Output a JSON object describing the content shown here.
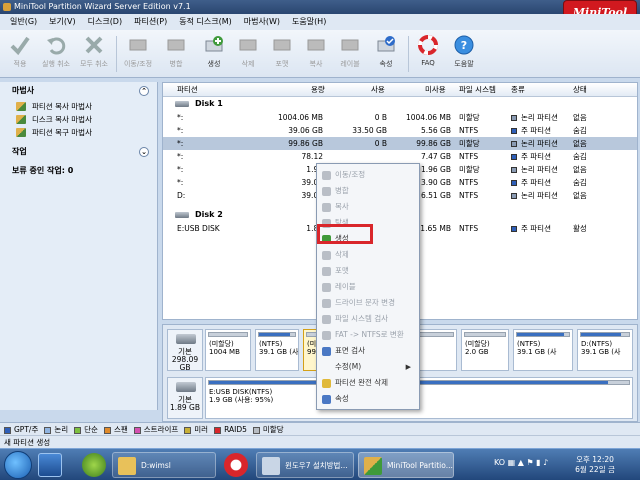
{
  "window": {
    "title": "MiniTool Partition Wizard Server Edition v7.1",
    "logo": "MiniTool"
  },
  "menu": [
    "일반(G)",
    "보기(V)",
    "디스크(D)",
    "파티션(P)",
    "동적 디스크(M)",
    "마법사(W)",
    "도움말(H)"
  ],
  "toolbar": {
    "apply": "적용",
    "undo": "실행 취소",
    "discard_all": "모두 취소",
    "move_resize": "이동/조정",
    "merge": "병합",
    "create": "생성",
    "delete": "삭제",
    "format": "포맷",
    "copy": "복사",
    "label": "레이블",
    "properties": "속성",
    "faq": "FAQ",
    "help": "도움말"
  },
  "sidebar": {
    "wizard_title": "마법사",
    "wizard_items": [
      "파티션 복사 마법사",
      "디스크 복사 마법사",
      "파티션 복구 마법사"
    ],
    "operations_title": "작업",
    "pending": "보류 중인 작업: 0"
  },
  "grid": {
    "headers": {
      "partition": "파티션",
      "capacity": "용량",
      "used": "사용",
      "unused": "미사용",
      "filesystem": "파일 시스템",
      "type": "종류",
      "status": "상태"
    },
    "disk1": "Disk 1",
    "disk2": "Disk 2",
    "rows": [
      {
        "partition": "*:",
        "capacity": "1004.06 MB",
        "used": "0 B",
        "unused": "1004.06 MB",
        "filesystem": "미할당",
        "type": "논리 파티션",
        "status": "없음",
        "type_color": "#8a9bb3"
      },
      {
        "partition": "*:",
        "capacity": "39.06 GB",
        "used": "33.50 GB",
        "unused": "5.56 GB",
        "filesystem": "NTFS",
        "type": "주 파티션",
        "status": "숨김",
        "type_color": "#2f5fb8"
      },
      {
        "partition": "*:",
        "capacity": "99.86 GB",
        "used": "0 B",
        "unused": "99.86 GB",
        "filesystem": "미할당",
        "type": "논리 파티션",
        "status": "없음",
        "type_color": "#8a9bb3"
      },
      {
        "partition": "*:",
        "capacity": "78.12",
        "used": "",
        "unused": "7.47 GB",
        "filesystem": "NTFS",
        "type": "주 파티션",
        "status": "숨김",
        "type_color": "#2f5fb8"
      },
      {
        "partition": "*:",
        "capacity": "1.96",
        "used": "",
        "unused": "1.96 GB",
        "filesystem": "미할당",
        "type": "논리 파티션",
        "status": "없음",
        "type_color": "#8a9bb3"
      },
      {
        "partition": "*:",
        "capacity": "39.05",
        "used": "",
        "unused": "3.90 GB",
        "filesystem": "NTFS",
        "type": "주 파티션",
        "status": "숨김",
        "type_color": "#2f5fb8"
      },
      {
        "partition": "D:",
        "capacity": "39.05",
        "used": "",
        "unused": "6.51 GB",
        "filesystem": "NTFS",
        "type": "논리 파티션",
        "status": "없음",
        "type_color": "#8a9bb3"
      }
    ],
    "disk2_rows": [
      {
        "partition": "E:USB DISK",
        "capacity": "1.88",
        "used": "",
        "unused": "1.65 MB",
        "filesystem": "NTFS",
        "type": "주 파티션",
        "status": "활성",
        "type_color": "#2f5fb8"
      }
    ]
  },
  "map": {
    "disk1": {
      "label": "기본",
      "size": "298.09 GB"
    },
    "disk2": {
      "label": "기본",
      "size": "1.89 GB"
    },
    "blocks": [
      {
        "name": "(미할당)",
        "size": "1004 MB",
        "fill": 0
      },
      {
        "name": "(NTFS)",
        "size": "39.1 GB (사용:",
        "fill": 85
      },
      {
        "name": "(미",
        "size": "99.9",
        "fill": 0
      },
      {
        "name": "NTFS)",
        "size": "1 GB (사용: 39%)",
        "fill": 39
      },
      {
        "name": "(미할당)",
        "size": "2.0 GB",
        "fill": 0
      },
      {
        "name": "(NTFS)",
        "size": "39.1 GB (사",
        "fill": 90
      },
      {
        "name": "D:(NTFS)",
        "size": "39.1 GB (사",
        "fill": 83
      }
    ],
    "usb": {
      "name": "E:USB DISK(NTFS)",
      "size": "1.9 GB (사용: 95%)",
      "fill": 95
    }
  },
  "context_menu": {
    "items": [
      {
        "label": "이동/조정",
        "disabled": true,
        "icon": "gray"
      },
      {
        "label": "병합",
        "disabled": true,
        "icon": "gray"
      },
      {
        "label": "복사",
        "disabled": true,
        "icon": "gray"
      },
      {
        "label": "탐색",
        "disabled": true,
        "icon": "gray"
      },
      {
        "label": "생성",
        "disabled": false,
        "icon": "green"
      },
      {
        "label": "삭제",
        "disabled": true,
        "icon": "gray"
      },
      {
        "label": "포맷",
        "disabled": true,
        "icon": "gray"
      },
      {
        "label": "레이블",
        "disabled": true,
        "icon": "gray"
      },
      {
        "label": "드라이브 문자 변경",
        "disabled": true,
        "icon": "gray"
      },
      {
        "label": "파일 시스템 검사",
        "disabled": true,
        "icon": "gray"
      },
      {
        "label": "FAT -> NTFS로 변환",
        "disabled": true,
        "icon": "gray"
      },
      {
        "label": "표면 검사",
        "disabled": false,
        "icon": "blue"
      },
      {
        "label": "수정(M)",
        "disabled": false,
        "icon": "none"
      },
      {
        "label": "파티션 완전 삭제",
        "disabled": false,
        "icon": "yellow"
      },
      {
        "label": "속성",
        "disabled": false,
        "icon": "blue"
      }
    ]
  },
  "legend": [
    {
      "label": "GPT/주",
      "color": "#2f5fb8"
    },
    {
      "label": "논리",
      "color": "#8fb3e0"
    },
    {
      "label": "단순",
      "color": "#7cc040"
    },
    {
      "label": "스팬",
      "color": "#e08a2a"
    },
    {
      "label": "스트라이프",
      "color": "#d44fb0"
    },
    {
      "label": "미러",
      "color": "#c8b036"
    },
    {
      "label": "RAID5",
      "color": "#d9262b"
    },
    {
      "label": "미할당",
      "color": "#b7bcc2"
    }
  ],
  "status": "새 파티션 생성",
  "taskbar": {
    "explorer": "D:wimsl",
    "browser": "윈도우7 설치방법...",
    "app": "MiniTool Partitio...",
    "time": "오후 12:20",
    "date": "6월 22일 금",
    "tray": "KO"
  }
}
